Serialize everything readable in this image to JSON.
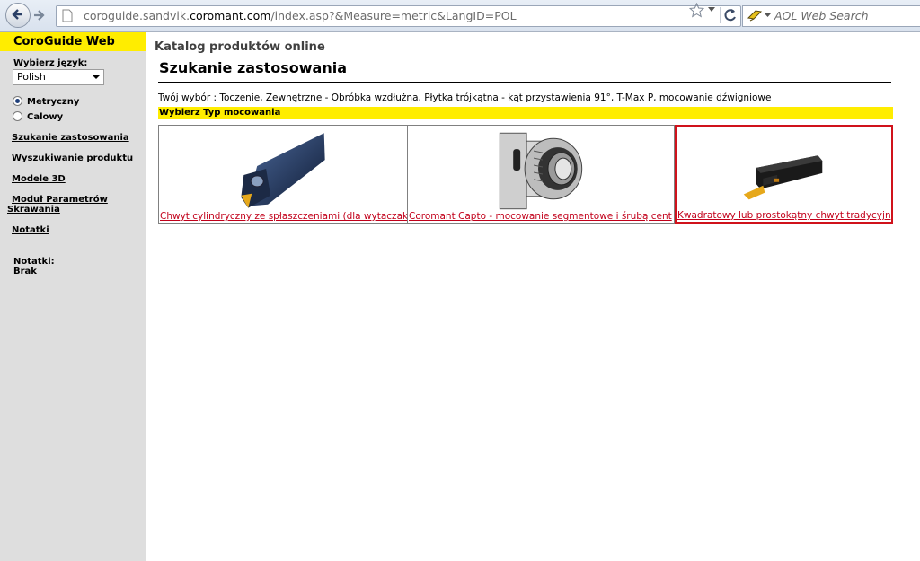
{
  "browser": {
    "url_prefix": "coroguide.sandvik.",
    "url_domain": "coromant.com",
    "url_suffix": "/index.asp?&Measure=metric&LangID=POL",
    "search_placeholder": "AOL Web Search"
  },
  "sidebar": {
    "title": "CoroGuide Web",
    "language_label": "Wybierz język:",
    "language_value": "Polish",
    "units": [
      {
        "label": "Metryczny",
        "checked": true
      },
      {
        "label": "Calowy",
        "checked": false
      }
    ],
    "links": [
      "Szukanie zastosowania",
      "Wyszukiwanie produktu",
      "Modele 3D",
      "Moduł Parametrów",
      "Skrawania",
      "Notatki"
    ],
    "notes_label": "Notatki:",
    "notes_value": "Brak"
  },
  "main": {
    "catalog_title": "Katalog produktów online",
    "page_title": "Szukanie zastosowania",
    "selection_text": "Twój wybór : Toczenie, Zewnętrzne - Obróbka wzdłużna, Płytka trójkątna - kąt przystawienia 91°, T-Max P, mocowanie dźwigniowe",
    "section_header": "Wybierz Typ mocowania",
    "options": [
      {
        "caption": "Chwyt cylindryczny ze spłaszczeniami (dla wytaczak",
        "selected": false
      },
      {
        "caption": "Coromant Capto - mocowanie segmentowe i śrubą cent",
        "selected": false
      },
      {
        "caption": "Kwadratowy lub prostokątny chwyt tradycyjny",
        "selected": true
      }
    ]
  },
  "colors": {
    "accent_yellow": "#ffed00",
    "sidebar_gray": "#dedede",
    "link_red": "#c2001a",
    "selected_border": "#d0121b"
  }
}
